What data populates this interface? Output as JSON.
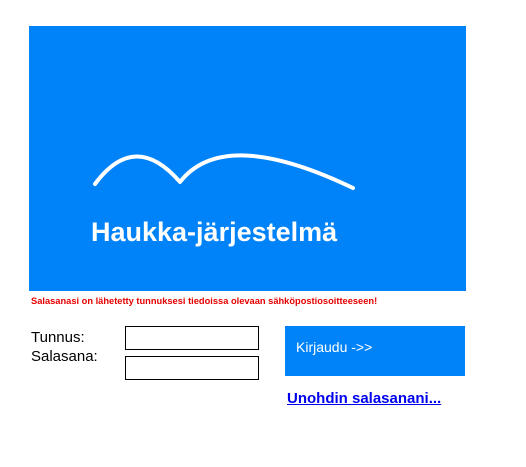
{
  "banner": {
    "title": "Haukka-järjestelmä",
    "logo_icon": "hawk-wings-icon",
    "background_color": "#0083f9"
  },
  "notice": {
    "text": "Salasanasi on lähetetty tunnuksesi tiedoissa olevaan sähköpostiosoitteeseen!",
    "color": "#e60000"
  },
  "form": {
    "username_label": "Tunnus:",
    "password_label": "Salasana:",
    "username_value": "",
    "password_value": "",
    "login_button_label": "Kirjaudu ->>",
    "forgot_password_link": "Unohdin salasanani..."
  }
}
